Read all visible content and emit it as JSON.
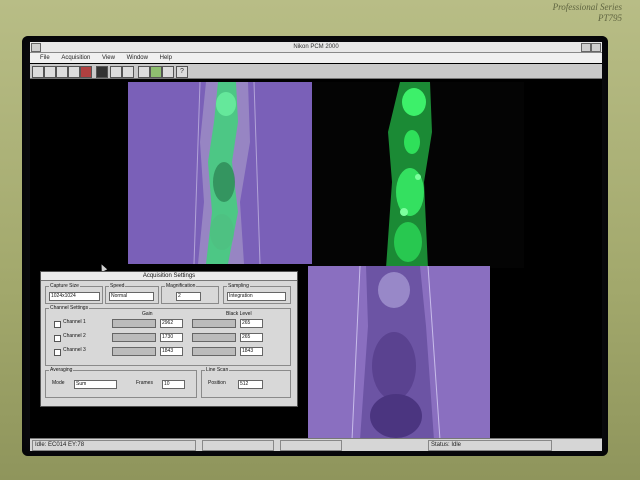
{
  "monitor": {
    "brand_line1": "Professional Series",
    "brand_line2": "PT795"
  },
  "app": {
    "title": "Nikon PCM 2000",
    "menus": [
      "File",
      "Acquisition",
      "View",
      "Window",
      "Help"
    ],
    "toolbar_icons": [
      "open-icon",
      "save-icon",
      "camera-icon",
      "scan-icon",
      "film-icon",
      "stop-icon",
      "zoom-in-icon",
      "zoom-out-icon",
      "adjust-icon",
      "color-icon",
      "grid-icon",
      "help-icon"
    ]
  },
  "dialog": {
    "title": "Acquisition Settings",
    "capture_size": {
      "label": "Capture Size",
      "value": "1024x1024"
    },
    "speed": {
      "label": "Speed",
      "value": "Normal"
    },
    "magnification": {
      "label": "Magnification",
      "value": "2"
    },
    "sampling": {
      "label": "Sampling",
      "value": "Integration"
    },
    "channel_settings_label": "Channel Settings",
    "gain_label": "Gain",
    "black_level_label": "Black Level",
    "channels": [
      {
        "name": "Channel 1",
        "gain": "2962",
        "black": "265"
      },
      {
        "name": "Channel 2",
        "gain": "1730",
        "black": "265"
      },
      {
        "name": "Channel 3",
        "gain": "1843",
        "black": "1843"
      }
    ],
    "averaging": {
      "label": "Averaging",
      "mode_label": "Mode",
      "mode_value": "Sum",
      "frames_label": "Frames",
      "frames_value": "10"
    },
    "line_scan": {
      "label": "Line Scan",
      "position_label": "Position",
      "position_value": "512"
    }
  },
  "status": {
    "left": "Idle: EC014 EY:78",
    "right": "Status: Idle"
  },
  "colors": {
    "purple": "#7a60b8",
    "green": "#2fe05a",
    "screen": "#0b0b10"
  }
}
